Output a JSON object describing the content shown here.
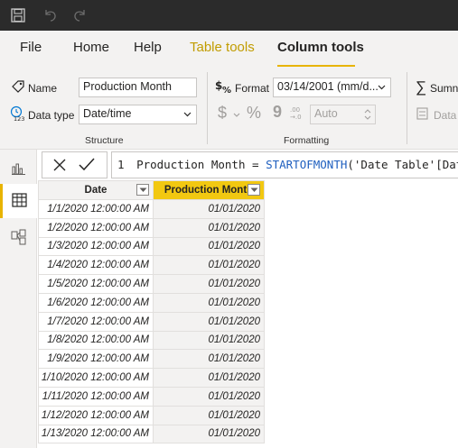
{
  "ribbon_tabs": [
    {
      "label": "File"
    },
    {
      "label": "Home"
    },
    {
      "label": "Help"
    },
    {
      "label": "Table tools"
    },
    {
      "label": "Column tools"
    }
  ],
  "structure": {
    "name_label": "Name",
    "name_value": "Production Month",
    "datatype_label": "Data type",
    "datatype_value": "Date/time",
    "group_label": "Structure"
  },
  "formatting": {
    "format_label": "Format",
    "format_value": "03/14/2001 (mm/d...",
    "currency_symbol": "$",
    "percent_symbol": "%",
    "comma_symbol": "9",
    "decimal_places_value": "Auto",
    "group_label": "Formatting"
  },
  "properties": {
    "summarize_label": "Sumn",
    "data_category_label": "Data"
  },
  "formula_bar": {
    "line_number": "1",
    "text_before": "Production Month = ",
    "function_name": "STARTOFMONTH",
    "text_after": "('Date Table'[Date])"
  },
  "table": {
    "headers": [
      "Date",
      "Production Month"
    ],
    "rows": [
      [
        "1/1/2020 12:00:00 AM",
        "01/01/2020"
      ],
      [
        "1/2/2020 12:00:00 AM",
        "01/01/2020"
      ],
      [
        "1/3/2020 12:00:00 AM",
        "01/01/2020"
      ],
      [
        "1/4/2020 12:00:00 AM",
        "01/01/2020"
      ],
      [
        "1/5/2020 12:00:00 AM",
        "01/01/2020"
      ],
      [
        "1/6/2020 12:00:00 AM",
        "01/01/2020"
      ],
      [
        "1/7/2020 12:00:00 AM",
        "01/01/2020"
      ],
      [
        "1/8/2020 12:00:00 AM",
        "01/01/2020"
      ],
      [
        "1/9/2020 12:00:00 AM",
        "01/01/2020"
      ],
      [
        "1/10/2020 12:00:00 AM",
        "01/01/2020"
      ],
      [
        "1/11/2020 12:00:00 AM",
        "01/01/2020"
      ],
      [
        "1/12/2020 12:00:00 AM",
        "01/01/2020"
      ],
      [
        "1/13/2020 12:00:00 AM",
        "01/01/2020"
      ]
    ]
  },
  "colors": {
    "accent": "#e8b400",
    "selected_header": "#f2c811",
    "titlebar": "#2b2b2b",
    "function_blue": "#1f5fbf"
  },
  "icons": [
    "save-icon",
    "undo-icon",
    "redo-icon",
    "tag-icon",
    "datatype-icon",
    "format-icon",
    "sigma-icon",
    "category-icon",
    "report-view-icon",
    "data-view-icon",
    "model-view-icon",
    "cancel-icon",
    "commit-icon",
    "dropdown-icon"
  ]
}
